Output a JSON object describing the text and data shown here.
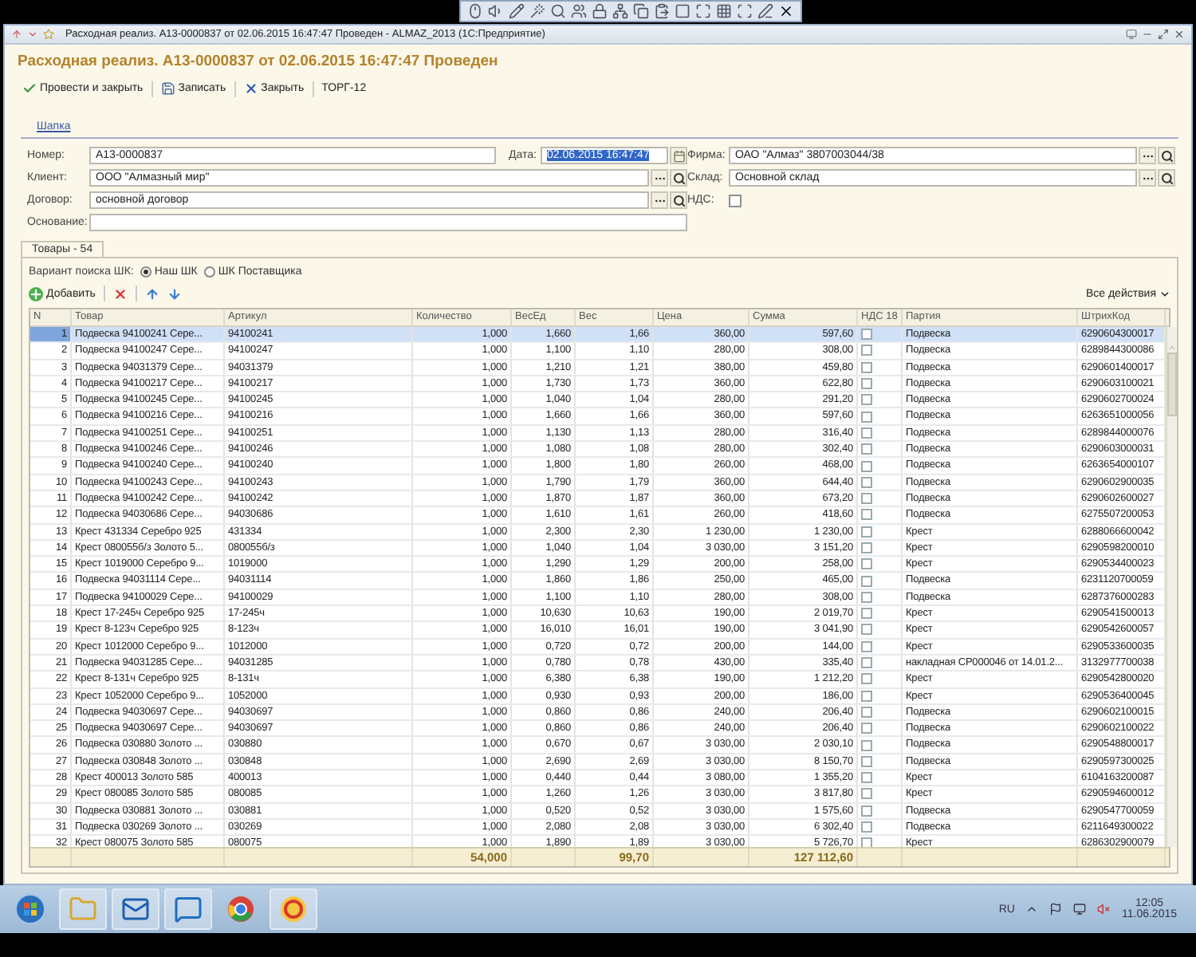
{
  "window": {
    "title": "Расходная реализ. А13-0000837 от 02.06.2015 16:47:47 Проведен - ALMAZ_2013  (1С:Предприятие)"
  },
  "document": {
    "heading": "Расходная реализ. А13-0000837 от 02.06.2015 16:47:47 Проведен"
  },
  "commands": [
    {
      "kind": "post",
      "label": "Провести и закрыть"
    },
    {
      "kind": "save",
      "label": "Записать"
    },
    {
      "kind": "close",
      "label": "Закрыть"
    },
    {
      "kind": "plain",
      "label": "ТОРГ-12"
    }
  ],
  "section_link": "Шапка",
  "header_fields": {
    "number": {
      "label": "Номер:",
      "value": "А13-0000837"
    },
    "date": {
      "label": "Дата:",
      "value": "02.06.2015 16:47:47",
      "highlighted": true
    },
    "firm": {
      "label": "Фирма:",
      "value": "ОАО \"Алмаз\" 3807003044/38"
    },
    "client": {
      "label": "Клиент:",
      "value": "ООО \"Алмазный мир\""
    },
    "warehouse": {
      "label": "Склад:",
      "value": "Основной склад"
    },
    "contract": {
      "label": "Договор:",
      "value": "основной договор"
    },
    "vat": {
      "label": "НДС:",
      "checked": false
    },
    "basis": {
      "label": "Основание:"
    }
  },
  "tabs": [
    {
      "label": "Товары - 54",
      "selected": true
    }
  ],
  "search_variant": {
    "label": "Вариант поиска ШК:",
    "options": [
      {
        "label": "Наш ШК",
        "selected": true
      },
      {
        "label": "ШК Поставщика",
        "selected": false
      }
    ]
  },
  "table_toolbar": {
    "add_label": "Добавить",
    "all_actions": "Все действия"
  },
  "table": {
    "columns": [
      {
        "label": "N",
        "kind": "number"
      },
      {
        "label": "Товар",
        "kind": "text"
      },
      {
        "label": "Артикул",
        "kind": "text"
      },
      {
        "label": "Количество",
        "kind": "number"
      },
      {
        "label": "ВесЕд",
        "kind": "number"
      },
      {
        "label": "Вес",
        "kind": "number"
      },
      {
        "label": "Цена",
        "kind": "number"
      },
      {
        "label": "Сумма",
        "kind": "number"
      },
      {
        "label": "НДС 18",
        "kind": "check"
      },
      {
        "label": "Партия",
        "kind": "text"
      },
      {
        "label": "ШтрихКод",
        "kind": "text"
      }
    ],
    "rows": [
      {
        "selected": true,
        "cells": [
          "1",
          "Подвеска 94100241 Сере...",
          "94100241",
          "1,000",
          "1,660",
          "1,66",
          "360,00",
          "597,60",
          {
            "checked": false
          },
          "Подвеска",
          "6290604300017"
        ]
      },
      {
        "selected": false,
        "cells": [
          "2",
          "Подвеска 94100247 Сере...",
          "94100247",
          "1,000",
          "1,100",
          "1,10",
          "280,00",
          "308,00",
          {
            "checked": false
          },
          "Подвеска",
          "6289844300086"
        ]
      },
      {
        "selected": false,
        "cells": [
          "3",
          "Подвеска 94031379 Сере...",
          "94031379",
          "1,000",
          "1,210",
          "1,21",
          "380,00",
          "459,80",
          {
            "checked": false
          },
          "Подвеска",
          "6290601400017"
        ]
      },
      {
        "selected": false,
        "cells": [
          "4",
          "Подвеска 94100217 Сере...",
          "94100217",
          "1,000",
          "1,730",
          "1,73",
          "360,00",
          "622,80",
          {
            "checked": false
          },
          "Подвеска",
          "6290603100021"
        ]
      },
      {
        "selected": false,
        "cells": [
          "5",
          "Подвеска 94100245 Сере...",
          "94100245",
          "1,000",
          "1,040",
          "1,04",
          "280,00",
          "291,20",
          {
            "checked": false
          },
          "Подвеска",
          "6290602700024"
        ]
      },
      {
        "selected": false,
        "cells": [
          "6",
          "Подвеска 94100216 Сере...",
          "94100216",
          "1,000",
          "1,660",
          "1,66",
          "360,00",
          "597,60",
          {
            "checked": false
          },
          "Подвеска",
          "6263651000056"
        ]
      },
      {
        "selected": false,
        "cells": [
          "7",
          "Подвеска 94100251 Сере...",
          "94100251",
          "1,000",
          "1,130",
          "1,13",
          "280,00",
          "316,40",
          {
            "checked": false
          },
          "Подвеска",
          "6289844000076"
        ]
      },
      {
        "selected": false,
        "cells": [
          "8",
          "Подвеска 94100246 Сере...",
          "94100246",
          "1,000",
          "1,080",
          "1,08",
          "280,00",
          "302,40",
          {
            "checked": false
          },
          "Подвеска",
          "6290603000031"
        ]
      },
      {
        "selected": false,
        "cells": [
          "9",
          "Подвеска 94100240 Сере...",
          "94100240",
          "1,000",
          "1,800",
          "1,80",
          "260,00",
          "468,00",
          {
            "checked": false
          },
          "Подвеска",
          "6263654000107"
        ]
      },
      {
        "selected": false,
        "cells": [
          "10",
          "Подвеска 94100243 Сере...",
          "94100243",
          "1,000",
          "1,790",
          "1,79",
          "360,00",
          "644,40",
          {
            "checked": false
          },
          "Подвеска",
          "6290602900035"
        ]
      },
      {
        "selected": false,
        "cells": [
          "11",
          "Подвеска 94100242 Сере...",
          "94100242",
          "1,000",
          "1,870",
          "1,87",
          "360,00",
          "673,20",
          {
            "checked": false
          },
          "Подвеска",
          "6290602600027"
        ]
      },
      {
        "selected": false,
        "cells": [
          "12",
          "Подвеска 94030686 Сере...",
          "94030686",
          "1,000",
          "1,610",
          "1,61",
          "260,00",
          "418,60",
          {
            "checked": false
          },
          "Подвеска",
          "6275507200053"
        ]
      },
      {
        "selected": false,
        "cells": [
          "13",
          "Крест 431334 Серебро 925",
          "431334",
          "1,000",
          "2,300",
          "2,30",
          "1 230,00",
          "1 230,00",
          {
            "checked": false
          },
          "Крест",
          "6288066600042"
        ]
      },
      {
        "selected": false,
        "cells": [
          "14",
          "Крест 080055б/з Золото 5...",
          "080055б/з",
          "1,000",
          "1,040",
          "1,04",
          "3 030,00",
          "3 151,20",
          {
            "checked": false
          },
          "Крест",
          "6290598200010"
        ]
      },
      {
        "selected": false,
        "cells": [
          "15",
          "Крест 1019000 Серебро 9...",
          "1019000",
          "1,000",
          "1,290",
          "1,29",
          "200,00",
          "258,00",
          {
            "checked": false
          },
          "Крест",
          "6290534400023"
        ]
      },
      {
        "selected": false,
        "cells": [
          "16",
          "Подвеска 94031114 Сере...",
          "94031114",
          "1,000",
          "1,860",
          "1,86",
          "250,00",
          "465,00",
          {
            "checked": false
          },
          "Подвеска",
          "6231120700059"
        ]
      },
      {
        "selected": false,
        "cells": [
          "17",
          "Подвеска 94100029 Сере...",
          "94100029",
          "1,000",
          "1,100",
          "1,10",
          "280,00",
          "308,00",
          {
            "checked": false
          },
          "Подвеска",
          "6287376000283"
        ]
      },
      {
        "selected": false,
        "cells": [
          "18",
          "Крест 17-245ч Серебро 925",
          "17-245ч",
          "1,000",
          "10,630",
          "10,63",
          "190,00",
          "2 019,70",
          {
            "checked": false
          },
          "Крест",
          "6290541500013"
        ]
      },
      {
        "selected": false,
        "cells": [
          "19",
          "Крест 8-123ч Серебро 925",
          "8-123ч",
          "1,000",
          "16,010",
          "16,01",
          "190,00",
          "3 041,90",
          {
            "checked": false
          },
          "Крест",
          "6290542600057"
        ]
      },
      {
        "selected": false,
        "cells": [
          "20",
          "Крест 1012000 Серебро 9...",
          "1012000",
          "1,000",
          "0,720",
          "0,72",
          "200,00",
          "144,00",
          {
            "checked": false
          },
          "Крест",
          "6290533600035"
        ]
      },
      {
        "selected": false,
        "cells": [
          "21",
          "Подвеска 94031285 Сере...",
          "94031285",
          "1,000",
          "0,780",
          "0,78",
          "430,00",
          "335,40",
          {
            "checked": false
          },
          "накладная СР000046 от 14.01.2...",
          "3132977700038"
        ]
      },
      {
        "selected": false,
        "cells": [
          "22",
          "Крест 8-131ч Серебро 925",
          "8-131ч",
          "1,000",
          "6,380",
          "6,38",
          "190,00",
          "1 212,20",
          {
            "checked": false
          },
          "Крест",
          "6290542800020"
        ]
      },
      {
        "selected": false,
        "cells": [
          "23",
          "Крест 1052000 Серебро 9...",
          "1052000",
          "1,000",
          "0,930",
          "0,93",
          "200,00",
          "186,00",
          {
            "checked": false
          },
          "Крест",
          "6290536400045"
        ]
      },
      {
        "selected": false,
        "cells": [
          "24",
          "Подвеска 94030697 Сере...",
          "94030697",
          "1,000",
          "0,860",
          "0,86",
          "240,00",
          "206,40",
          {
            "checked": false
          },
          "Подвеска",
          "6290602100015"
        ]
      },
      {
        "selected": false,
        "cells": [
          "25",
          "Подвеска 94030697 Сере...",
          "94030697",
          "1,000",
          "0,860",
          "0,86",
          "240,00",
          "206,40",
          {
            "checked": false
          },
          "Подвеска",
          "6290602100022"
        ]
      },
      {
        "selected": false,
        "cells": [
          "26",
          "Подвеска 030880 Золото ...",
          "030880",
          "1,000",
          "0,670",
          "0,67",
          "3 030,00",
          "2 030,10",
          {
            "checked": false
          },
          "Подвеска",
          "6290548800017"
        ]
      },
      {
        "selected": false,
        "cells": [
          "27",
          "Подвеска 030848 Золото ...",
          "030848",
          "1,000",
          "2,690",
          "2,69",
          "3 030,00",
          "8 150,70",
          {
            "checked": false
          },
          "Подвеска",
          "6290597300025"
        ]
      },
      {
        "selected": false,
        "cells": [
          "28",
          "Крест 400013 Золото 585",
          "400013",
          "1,000",
          "0,440",
          "0,44",
          "3 080,00",
          "1 355,20",
          {
            "checked": false
          },
          "Крест",
          "6104163200087"
        ]
      },
      {
        "selected": false,
        "cells": [
          "29",
          "Крест 080085 Золото 585",
          "080085",
          "1,000",
          "1,260",
          "1,26",
          "3 030,00",
          "3 817,80",
          {
            "checked": false
          },
          "Крест",
          "6290594600012"
        ]
      },
      {
        "selected": false,
        "cells": [
          "30",
          "Подвеска 030881 Золото ...",
          "030881",
          "1,000",
          "0,520",
          "0,52",
          "3 030,00",
          "1 575,60",
          {
            "checked": false
          },
          "Подвеска",
          "6290547700059"
        ]
      },
      {
        "selected": false,
        "cells": [
          "31",
          "Подвеска 030269 Золото ...",
          "030269",
          "1,000",
          "2,080",
          "2,08",
          "3 030,00",
          "6 302,40",
          {
            "checked": false
          },
          "Подвеска",
          "6211649300022"
        ]
      },
      {
        "selected": false,
        "cells": [
          "32",
          "Крест 080075 Золото 585",
          "080075",
          "1,000",
          "1,890",
          "1,89",
          "3 030,00",
          "5 726,70",
          {
            "checked": false
          },
          "Крест",
          "6286302900079"
        ]
      }
    ],
    "totals": {
      "quantity": "54,000",
      "weight": "99,70",
      "sum": "127 112,60"
    }
  },
  "taskbar": {
    "language": "RU",
    "time": "12:05",
    "date": "11.06.2015"
  }
}
